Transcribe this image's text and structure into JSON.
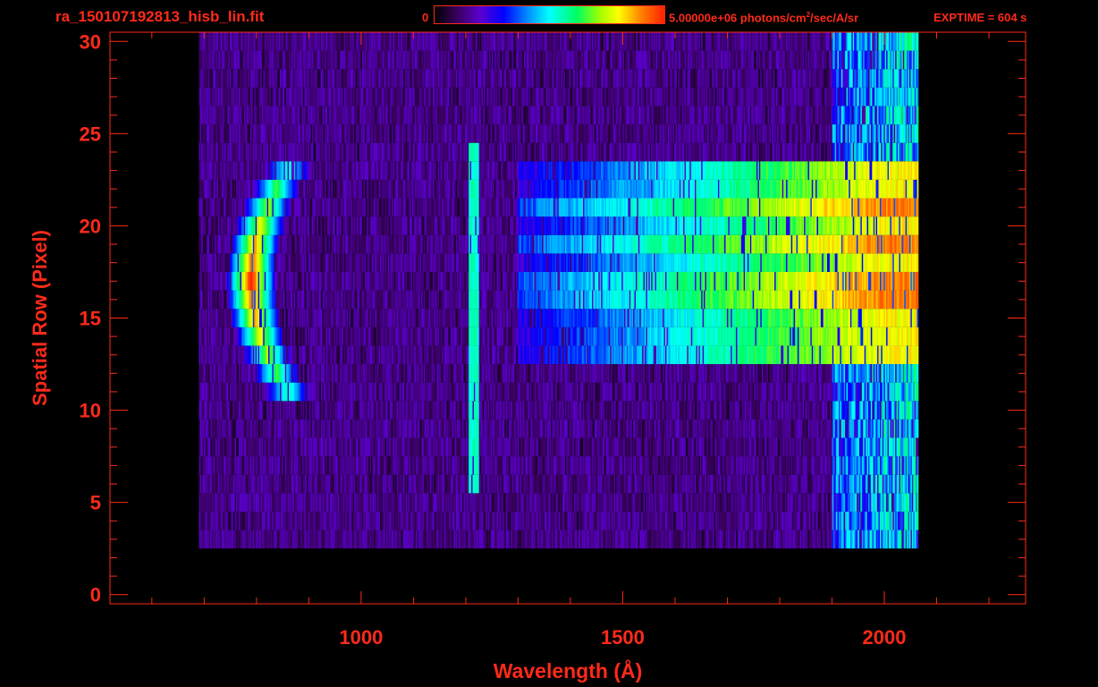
{
  "header": {
    "filename": "ra_150107192813_hisb_lin.fit",
    "colorbar_min": "0",
    "colorbar_max_prefix": "5.00000e+06 photons/cm",
    "colorbar_max_exp": "2",
    "colorbar_max_suffix": "/sec/A/sr",
    "exptime": "EXPTIME = 604 s"
  },
  "colors": {
    "axis": "#ff2a1a",
    "background": "#000000"
  },
  "chart_data": {
    "type": "heatmap",
    "title": "ra_150107192813_hisb_lin.fit",
    "xlabel": "Wavelength (Å)",
    "ylabel": "Spatial Row (Pixel)",
    "xlim": [
      520,
      2270
    ],
    "ylim": [
      -0.5,
      30.5
    ],
    "xticks": [
      1000,
      1500,
      2000
    ],
    "xtick_labels": [
      "1000",
      "1500",
      "2000"
    ],
    "yticks": [
      0,
      5,
      10,
      15,
      20,
      25,
      30
    ],
    "ytick_labels": [
      "0",
      "5",
      "10",
      "15",
      "20",
      "25",
      "30"
    ],
    "colorbar": {
      "min": 0,
      "max": 5000000,
      "units": "photons/cm^2/sec/A/sr",
      "colormap": "rainbow"
    },
    "data_extent": {
      "x": [
        690,
        2065
      ],
      "y": [
        3,
        30
      ]
    },
    "features": [
      {
        "name": "arc",
        "wavelength": [
          800,
          880
        ],
        "rows": [
          11,
          23
        ],
        "peak": 1.0
      },
      {
        "name": "line",
        "wavelength": 1215,
        "rows": [
          6,
          24
        ],
        "peak": 0.55
      },
      {
        "name": "continuum",
        "wavelength": [
          1500,
          2060
        ],
        "rows": [
          13,
          23
        ],
        "peak": 0.85
      }
    ],
    "grid": false
  },
  "axes": {
    "xlabel": "Wavelength (Å)",
    "ylabel": "Spatial Row (Pixel)"
  }
}
